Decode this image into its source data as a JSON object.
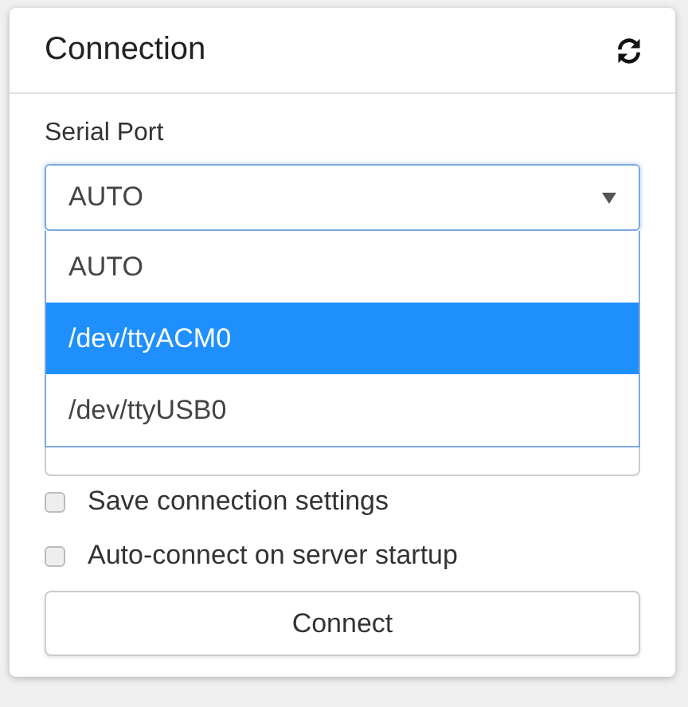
{
  "panel": {
    "title": "Connection"
  },
  "serial_port": {
    "label": "Serial Port",
    "value": "AUTO",
    "expanded": true,
    "options": [
      {
        "label": "AUTO",
        "highlighted": false
      },
      {
        "label": "/dev/ttyACM0",
        "highlighted": true
      },
      {
        "label": "/dev/ttyUSB0",
        "highlighted": false
      }
    ]
  },
  "settings": [
    {
      "label": "Save connection settings",
      "checked": false
    },
    {
      "label": "Auto-connect on server startup",
      "checked": false
    }
  ],
  "buttons": [
    {
      "label": "Connect"
    }
  ]
}
